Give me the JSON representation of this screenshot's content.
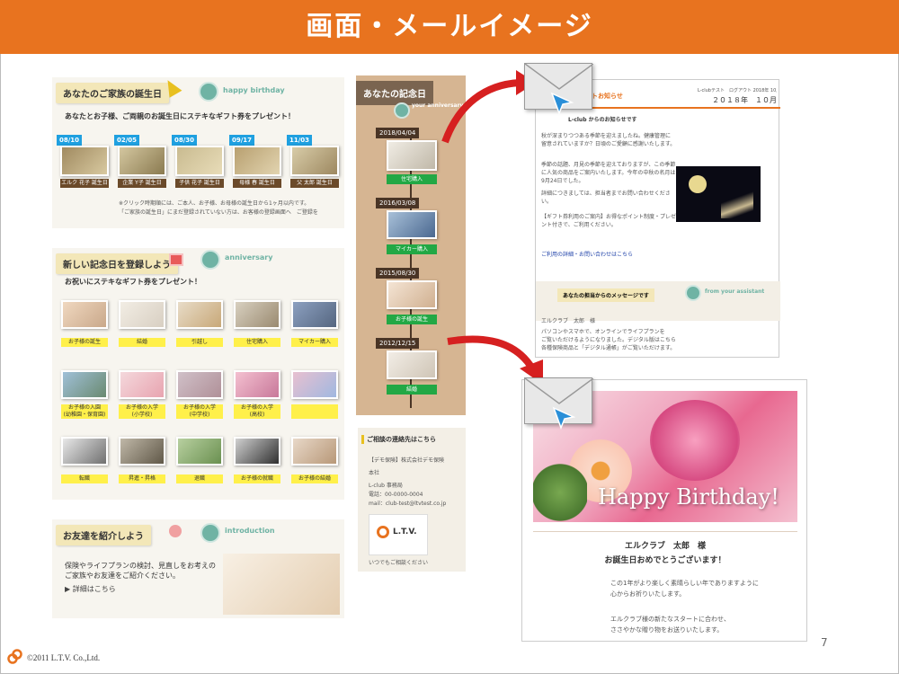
{
  "header": {
    "title": "画面・メールイメージ"
  },
  "birthday_section": {
    "tag": "あなたのご家族の誕生日",
    "badge": "happy birthday",
    "intro": "あなたとお子様、ご両親のお誕生日にステキなギフト券をプレゼント！",
    "dates": [
      "08/10",
      "02/05",
      "08/30",
      "09/17",
      "11/03"
    ],
    "captions": [
      "エルク 花子 誕生日",
      "企業 Y子 誕生日",
      "子供 花子 誕生日",
      "母様 春 誕生日",
      "父 太郎 誕生日"
    ],
    "note1": "※クリック時期順には、ご本人、お子様、お母様の誕生日から1ヶ月以内です。",
    "note2": "「ご家族の誕生日」にまだ登録されていない方は、お客様の登録画面へ　ご登録を"
  },
  "anniversary_section": {
    "tag": "新しい記念日を登録しよう",
    "badge": "anniversary",
    "intro": "お祝いにステキなギフト券をプレゼント！",
    "row1": [
      "お子様の誕生",
      "結婚",
      "引越し",
      "住宅購入",
      "マイカー購入"
    ],
    "row2": [
      "お子様の入園\n(幼稚園・保育園)",
      "お子様の入学\n(小学校)",
      "お子様の入学\n(中学校)",
      "お子様の入学\n(高校)",
      ""
    ],
    "row3": [
      "転職",
      "昇進・昇格",
      "退職",
      "お子様の就職",
      "お子様の結婚"
    ]
  },
  "introduction_section": {
    "tag": "お友達を紹介しよう",
    "badge": "introduction",
    "text1": "保険やライフプランの検討、見直しをお考えの",
    "text2": "ご家族やお友達をご紹介ください。",
    "link": "▶ 詳細はこちら"
  },
  "memorial_section": {
    "tag": "あなたの記念日",
    "badge": "your anniversary",
    "dates": [
      "2018/04/04",
      "2016/03/08",
      "2015/08/30",
      "2012/12/15"
    ],
    "buttons": [
      "住宅購入",
      "マイカー購入",
      "お子様の誕生",
      "結婚"
    ]
  },
  "contact_section": {
    "tag": "ご相談の連絡先はこちら",
    "company": "【デモ保険】株式会社デモ保険",
    "office": "本社",
    "name": "L-club 事務局",
    "phone": "電話：00-0000-0004",
    "mail": "mail：club-test@ltvtest.co.jp",
    "logo": "L.T.V.",
    "footer": "いつでもご相談ください"
  },
  "mail1": {
    "title_partial": "トお知らせ",
    "header_right": "L-clubテスト　ログアウト  2018年  10月",
    "year_month": "２０１８年　１０月",
    "heading": "L-club からのお知らせです",
    "p1": "秋が深まりつつある季節を迎えましたね。健康管理に留意されていますか？日頃のご愛顧に感謝いたします。",
    "p2": "季節の話題、月見の季節を迎えておりますが、この季節に人気の商品をご案内いたします。今年の中秋の名月は9月24日でした。",
    "p3": "詳細につきましては、担当者までお問い合わせください。",
    "p4": "【ギフト券利用のご案内】お得なポイント制度・プレゼント付きで、ご利用ください。",
    "p5": "ご利用の詳細・お問い合わせはこちら",
    "message_tag": "あなたの担当からのメッセージです",
    "message_badge": "from your assistant",
    "sign": "エルクラブ　太郎　様",
    "m1": "パソコンやスマホで、オンラインでライフプランを",
    "m2": "ご覧いただけるようになりました。デジタル版はこちら",
    "m3": "各種保険商品と「デジタル通帳」がご覧いただけます。"
  },
  "mail2": {
    "banner_text": "Happy Birthday!",
    "line1": "エルクラブ　太郎　様",
    "line2": "お誕生日おめでとうございます！",
    "line3": "この1年がより楽しく素晴らしい年でありますように",
    "line4": "心からお祈りいたします。",
    "line5": "エルクラブ様の新たなスタートに合わせ、",
    "line6": "ささやかな贈り物をお送りいたします。"
  },
  "footer": {
    "copyright": "©2011 L.T.V. Co.,Ltd.",
    "page_number": "7"
  },
  "colors": {
    "header": "#e8731f",
    "arrow": "#d62020",
    "accent_blue": "#1fa0e0",
    "green": "#22a845",
    "yellow": "#fff04a"
  }
}
